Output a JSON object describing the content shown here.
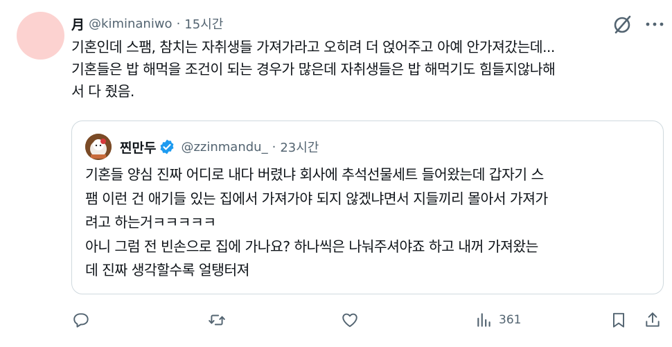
{
  "tweet": {
    "display_name": "月",
    "handle": "@kiminaniwo",
    "separator": "·",
    "time": "15시간",
    "text": "기혼인데 스팸, 참치는 자취생들 가져가라고 오히려 더 얹어주고 아예 안가져갔는데...\n기혼들은 밥 해먹을 조건이 되는 경우가 많은데 자취생들은 밥 해먹기도 힘들지않나해\n서 다 줬음."
  },
  "quote": {
    "display_name": "찐만두",
    "handle": "@zzinmandu_",
    "separator": "·",
    "time": "23시간",
    "text": "기혼들 양심 진짜 어디로 내다 버렸냐 회사에 추석선물세트 들어왔는데 갑자기 스\n팸 이런 건 애기들 있는 집에서 가져가야 되지 않겠냐면서 지들끼리 몰아서 가져가\n려고 하는거ㅋㅋㅋㅋㅋ\n아니 그럼 전 빈손으로 집에 가나요? 하나씩은 나눠주셔야죠 하고 내꺼 가져왔는\n데 진짜 생각할수록 얼탱터져"
  },
  "actions": {
    "reply_icon": "reply-icon",
    "retweet_icon": "retweet-icon",
    "like_icon": "heart-icon",
    "views_icon": "views-icon",
    "views_count": "361",
    "bookmark_icon": "bookmark-icon",
    "share_icon": "share-icon"
  },
  "icons": {
    "grok": "grok-icon",
    "more": "more-icon",
    "verified": "verified-badge-icon"
  },
  "colors": {
    "text": "#0f1419",
    "muted": "#536471",
    "verified": "#1d9bf0",
    "border": "#cfd9de",
    "avatar_pink": "#fcd2d0"
  }
}
